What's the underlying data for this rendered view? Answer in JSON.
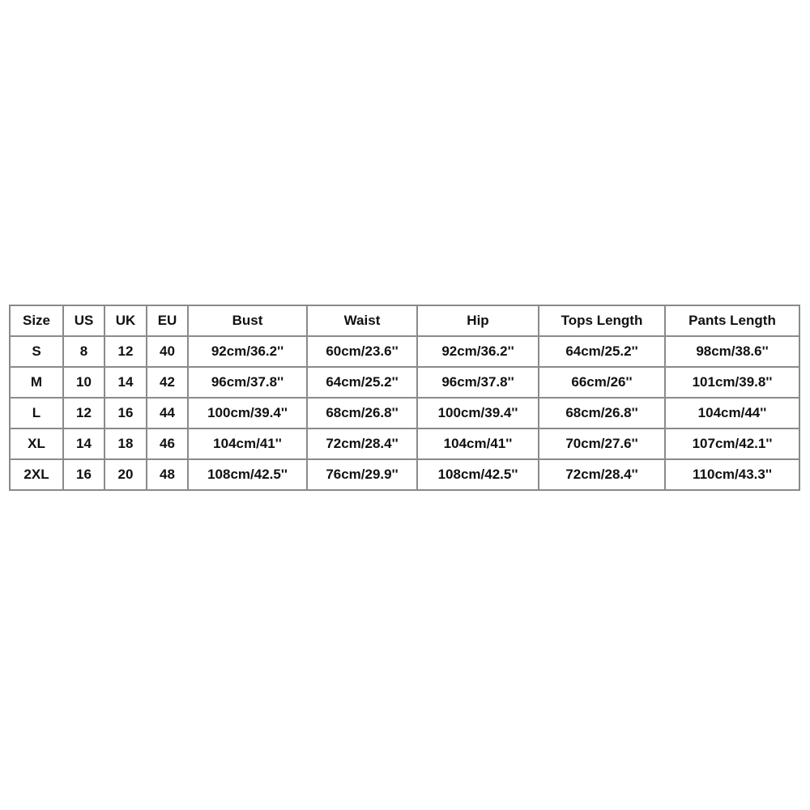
{
  "size_chart": {
    "headers": [
      "Size",
      "US",
      "UK",
      "EU",
      "Bust",
      "Waist",
      "Hip",
      "Tops Length",
      "Pants Length"
    ],
    "rows": [
      [
        "S",
        "8",
        "12",
        "40",
        "92cm/36.2''",
        "60cm/23.6''",
        "92cm/36.2''",
        "64cm/25.2''",
        "98cm/38.6''"
      ],
      [
        "M",
        "10",
        "14",
        "42",
        "96cm/37.8''",
        "64cm/25.2''",
        "96cm/37.8''",
        "66cm/26''",
        "101cm/39.8''"
      ],
      [
        "L",
        "12",
        "16",
        "44",
        "100cm/39.4''",
        "68cm/26.8''",
        "100cm/39.4''",
        "68cm/26.8''",
        "104cm/44''"
      ],
      [
        "XL",
        "14",
        "18",
        "46",
        "104cm/41''",
        "72cm/28.4''",
        "104cm/41''",
        "70cm/27.6''",
        "107cm/42.1''"
      ],
      [
        "2XL",
        "16",
        "20",
        "48",
        "108cm/42.5''",
        "76cm/29.9''",
        "108cm/42.5''",
        "72cm/28.4''",
        "110cm/43.3''"
      ]
    ]
  }
}
